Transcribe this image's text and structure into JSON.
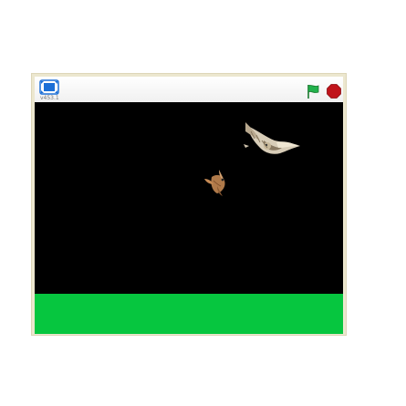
{
  "player": {
    "version_label": "v453.1",
    "colors": {
      "frame": "#ece7cf",
      "stage_background": "#000000",
      "ground": "#06c63f",
      "flag": "#22b14c",
      "stop": "#c0141b",
      "fullscreen": "#1c6fd6"
    },
    "icons": {
      "fullscreen": "fullscreen-icon",
      "green_flag": "green-flag-icon",
      "stop": "stop-icon"
    }
  },
  "stage": {
    "sprites": [
      "owl-sprite",
      "bird-sprite"
    ]
  }
}
